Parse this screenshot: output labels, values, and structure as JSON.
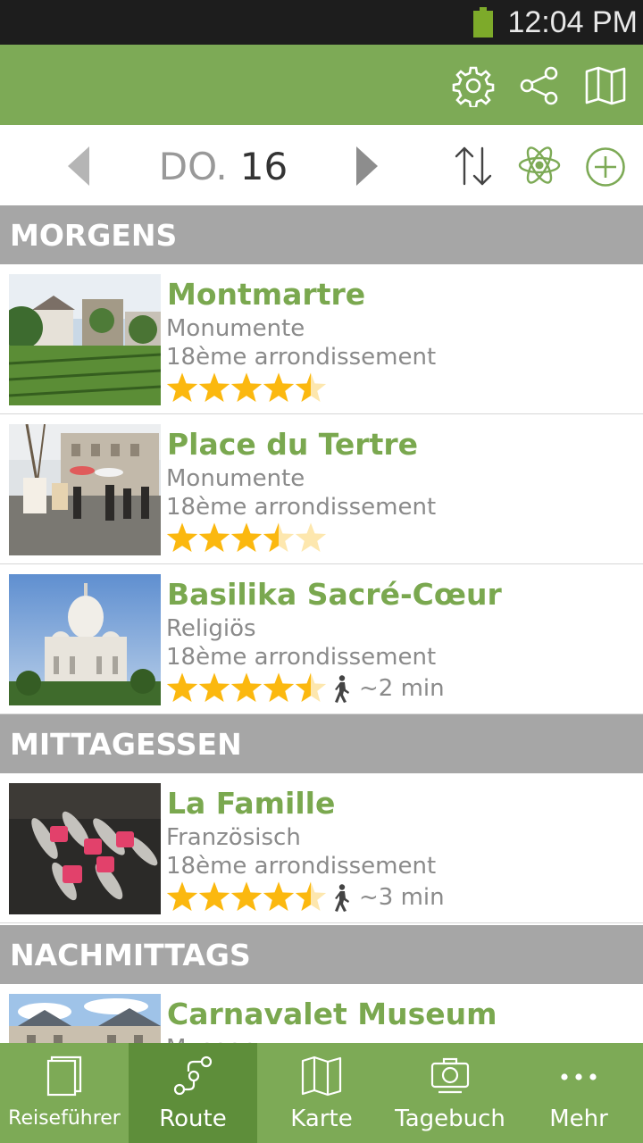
{
  "status_bar": {
    "time": "12:04 PM"
  },
  "day_nav": {
    "day_of_week": "DO.",
    "day_number": "16"
  },
  "sections": [
    {
      "title": "MORGENS",
      "items": [
        {
          "title": "Montmartre",
          "category": "Monumente",
          "area": "18ème arrondissement",
          "rating": 4.5,
          "walk_time": ""
        },
        {
          "title": "Place du Tertre",
          "category": "Monumente",
          "area": "18ème arrondissement",
          "rating": 3.5,
          "walk_time": ""
        },
        {
          "title": "Basilika Sacré-Cœur",
          "category": "Religiös",
          "area": "18ème arrondissement",
          "rating": 4.5,
          "walk_time": "~2 min"
        }
      ]
    },
    {
      "title": "MITTAGESSEN",
      "items": [
        {
          "title": "La Famille",
          "category": "Französisch",
          "area": "18ème arrondissement",
          "rating": 4.5,
          "walk_time": "~3 min"
        }
      ]
    },
    {
      "title": "NACHMITTAGS",
      "items": [
        {
          "title": "Carnavalet Museum",
          "category": "Museen",
          "area": "",
          "rating": 0,
          "walk_time": ""
        }
      ]
    }
  ],
  "bottom_nav": {
    "tabs": [
      {
        "label": "Reiseführer",
        "icon": "book-icon",
        "active": false
      },
      {
        "label": "Route",
        "icon": "route-icon",
        "active": true
      },
      {
        "label": "Karte",
        "icon": "map-icon",
        "active": false
      },
      {
        "label": "Tagebuch",
        "icon": "camera-icon",
        "active": false
      },
      {
        "label": "Mehr",
        "icon": "more-icon",
        "active": false
      }
    ]
  },
  "colors": {
    "accent": "#7daa56",
    "accent_dark": "#5e8e3a",
    "title_green": "#7aa84f",
    "section_gray": "#a6a6a6",
    "star": "#fbb80f"
  }
}
